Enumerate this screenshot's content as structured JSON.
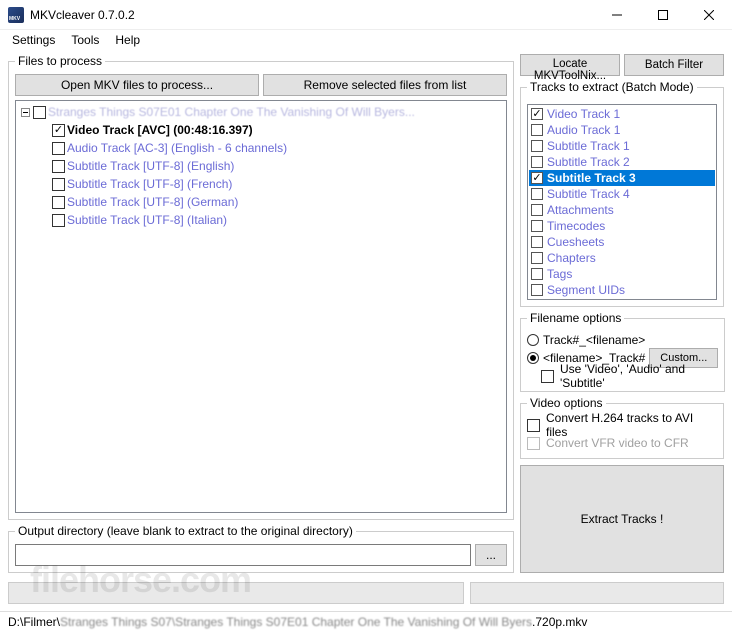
{
  "window": {
    "title": "MKVcleaver 0.7.0.2"
  },
  "menu": {
    "items": [
      "Settings",
      "Tools",
      "Help"
    ]
  },
  "files_group": {
    "legend": "Files to process",
    "open_btn": "Open MKV files to process...",
    "remove_btn": "Remove selected files from list"
  },
  "tree": {
    "root": "Stranges Things S07E01 Chapter One The Vanishing Of Will Byers...",
    "items": [
      {
        "label": "Video Track [AVC] (00:48:16.397)",
        "checked": true,
        "black": true
      },
      {
        "label": "Audio Track [AC-3] (English - 6 channels)",
        "checked": false,
        "black": false
      },
      {
        "label": "Subtitle Track [UTF-8] (English)",
        "checked": false,
        "black": false
      },
      {
        "label": "Subtitle Track [UTF-8] (French)",
        "checked": false,
        "black": false
      },
      {
        "label": "Subtitle Track [UTF-8] (German)",
        "checked": false,
        "black": false
      },
      {
        "label": "Subtitle Track [UTF-8] (Italian)",
        "checked": false,
        "black": false
      }
    ]
  },
  "output_group": {
    "legend": "Output directory (leave blank to extract to the original directory)",
    "value": "",
    "browse": "..."
  },
  "right_buttons": {
    "locate": "Locate MKVToolNix...",
    "batch": "Batch Filter"
  },
  "tracks_group": {
    "legend": "Tracks to extract (Batch Mode)",
    "items": [
      {
        "label": "Video Track 1",
        "checked": true,
        "selected": false
      },
      {
        "label": "Audio Track 1",
        "checked": false,
        "selected": false
      },
      {
        "label": "Subtitle Track 1",
        "checked": false,
        "selected": false
      },
      {
        "label": "Subtitle Track 2",
        "checked": false,
        "selected": false
      },
      {
        "label": "Subtitle Track 3",
        "checked": true,
        "selected": true
      },
      {
        "label": "Subtitle Track 4",
        "checked": false,
        "selected": false
      },
      {
        "label": "Attachments",
        "checked": false,
        "selected": false
      },
      {
        "label": "Timecodes",
        "checked": false,
        "selected": false
      },
      {
        "label": "Cuesheets",
        "checked": false,
        "selected": false
      },
      {
        "label": "Chapters",
        "checked": false,
        "selected": false
      },
      {
        "label": "Tags",
        "checked": false,
        "selected": false
      },
      {
        "label": "Segment UIDs",
        "checked": false,
        "selected": false
      }
    ]
  },
  "filename_group": {
    "legend": "Filename options",
    "opt1": "Track#_<filename>",
    "opt2": "<filename>_Track#",
    "custom": "Custom...",
    "use_names": "Use 'Video', 'Audio' and 'Subtitle'"
  },
  "video_group": {
    "legend": "Video options",
    "h264": "Convert H.264 tracks to AVI files",
    "vfr": "Convert VFR video to CFR"
  },
  "extract_btn": "Extract Tracks !",
  "watermark": "filehorse.com",
  "status": {
    "prefix": "D:\\Filmer\\",
    "blur": "Stranges Things S07\\Stranges Things S07E01 Chapter One The Vanishing Of Will Byers",
    "suffix": ".720p.mkv"
  }
}
